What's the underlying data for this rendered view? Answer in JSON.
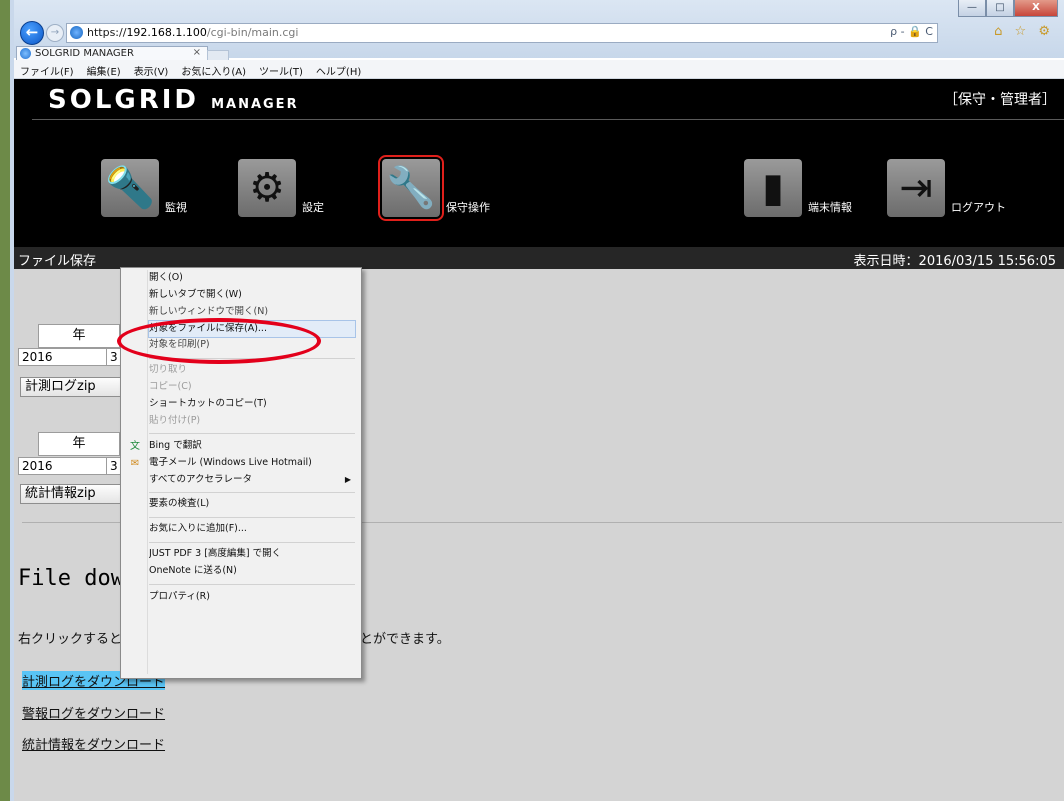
{
  "window": {
    "minimize_label": "—",
    "maximize_label": "□",
    "close_label": "X"
  },
  "browser": {
    "back_symbol": "←",
    "forward_symbol": "→",
    "address": {
      "scheme": "https://",
      "host": "192.168.1.100",
      "path": "/cgi-bin/main.cgi"
    },
    "address_tools": "ρ - 🔒 C",
    "toolbar_icons": "⌂ ☆ ⚙",
    "tab_title": "SOLGRID MANAGER",
    "tab_close": "×",
    "menu": [
      "ファイル(F)",
      "編集(E)",
      "表示(V)",
      "お気に入り(A)",
      "ツール(T)",
      "ヘルプ(H)"
    ]
  },
  "app": {
    "logo_main": "SOLGRID",
    "logo_sub": "MANAGER",
    "role": "［保守・管理者］",
    "nav": [
      {
        "label": "監視",
        "glyph": "🔦"
      },
      {
        "label": "設定",
        "glyph": "⚙"
      },
      {
        "label": "保守操作",
        "glyph": "🔧"
      },
      {
        "label": "端末情報",
        "glyph": "▮"
      },
      {
        "label": "ログアウト",
        "glyph": "⇥"
      }
    ],
    "page_title": "ファイル保存",
    "display_time": "表示日時：2016/03/15  15:56:05"
  },
  "forms": {
    "year_header": "年",
    "year_value_1": "2016",
    "year_value_2": "2016",
    "month_fragment": "3",
    "measure_btn": "計測ログzip",
    "stats_btn": "統計情報zip"
  },
  "download": {
    "title": "File download",
    "instruction": "右クリックすると",
    "instruction_tail": "とができます。",
    "links": [
      "計測ログをダウンロード",
      "警報ログをダウンロード",
      "統計情報をダウンロード"
    ]
  },
  "context_menu": {
    "items": [
      {
        "label": "開く(O)"
      },
      {
        "label": "新しいタブで開く(W)"
      },
      {
        "label": "新しいウィンドウで開く(N)"
      },
      {
        "label": "対象をファイルに保存(A)..."
      },
      {
        "label": "対象を印刷(P)"
      },
      {
        "label": "切り取り"
      },
      {
        "label": "コピー(C)"
      },
      {
        "label": "ショートカットのコピー(T)"
      },
      {
        "label": "貼り付け(P)"
      },
      {
        "label": "Bing で翻訳"
      },
      {
        "label": "電子メール (Windows Live Hotmail)"
      },
      {
        "label": "すべてのアクセラレータ"
      },
      {
        "label": "要素の検査(L)"
      },
      {
        "label": "お気に入りに追加(F)..."
      },
      {
        "label": "JUST PDF 3 [高度編集] で開く"
      },
      {
        "label": "OneNote に送る(N)"
      },
      {
        "label": "プロパティ(R)"
      }
    ],
    "submenu_arrow": "▶",
    "bing_icon": "文",
    "mail_icon": "✉"
  },
  "colors": {
    "highlight_ellipse": "#e3001b",
    "active_nav_outline": "#e0201b",
    "link_highlight": "#59c4f5"
  }
}
